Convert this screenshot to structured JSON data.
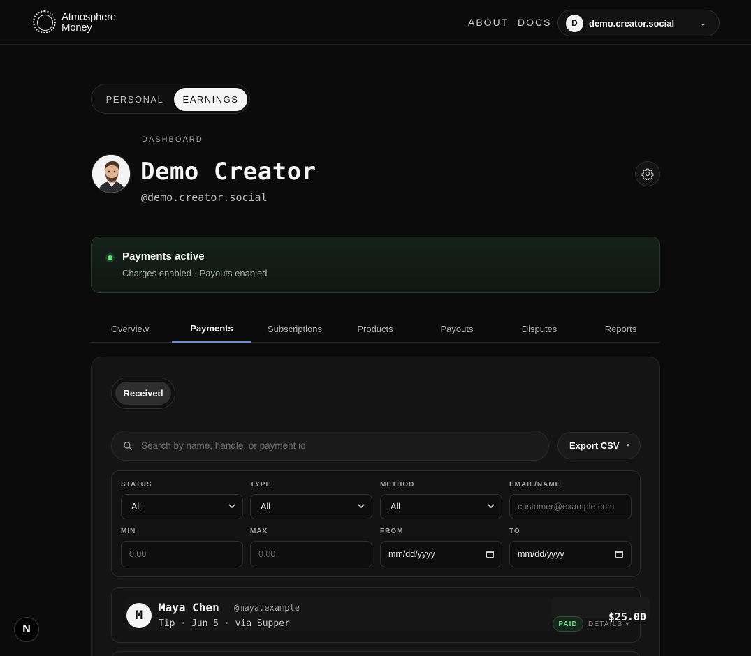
{
  "header": {
    "brand_line1": "Atmosphere",
    "brand_line2": "Money",
    "nav": {
      "about": "ABOUT",
      "docs": "DOCS"
    },
    "account": {
      "initial": "D",
      "handle": "demo.creator.social"
    }
  },
  "mode_toggle": {
    "personal": "PERSONAL",
    "earnings": "EARNINGS",
    "selected": "EARNINGS"
  },
  "profile": {
    "eyebrow": "DASHBOARD",
    "name": "Demo Creator",
    "handle": "@demo.creator.social"
  },
  "payment_status": {
    "title": "Payments active",
    "subtitle": "Charges enabled · Payouts enabled",
    "color": "#5fe07b"
  },
  "tabs": {
    "items": [
      {
        "label": "Overview"
      },
      {
        "label": "Payments"
      },
      {
        "label": "Subscriptions"
      },
      {
        "label": "Products"
      },
      {
        "label": "Payouts"
      },
      {
        "label": "Disputes"
      },
      {
        "label": "Reports"
      }
    ],
    "active": "Payments",
    "accent": "#6a8ee8"
  },
  "payments": {
    "segment": "Received",
    "search_placeholder": "Search by name, handle, or payment id",
    "export_label": "Export CSV",
    "filters": {
      "status": {
        "label": "STATUS",
        "value": "All"
      },
      "type": {
        "label": "TYPE",
        "value": "All"
      },
      "method": {
        "label": "METHOD",
        "value": "All"
      },
      "email": {
        "label": "EMAIL/NAME",
        "placeholder": "customer@example.com"
      },
      "min": {
        "label": "MIN",
        "placeholder": "0.00"
      },
      "max": {
        "label": "MAX",
        "placeholder": "0.00"
      },
      "from": {
        "label": "FROM",
        "value": "mm/dd/yyyy"
      },
      "to": {
        "label": "TO",
        "value": "mm/dd/yyyy"
      }
    },
    "rows": [
      {
        "initial": "M",
        "name": "Maya Chen",
        "handle": "@maya.example",
        "meta": "Tip · Jun 5 · via Supper",
        "amount": "$25.00",
        "status": "PAID",
        "details": "DETAILS ▾"
      }
    ]
  },
  "dev_badge": "N"
}
